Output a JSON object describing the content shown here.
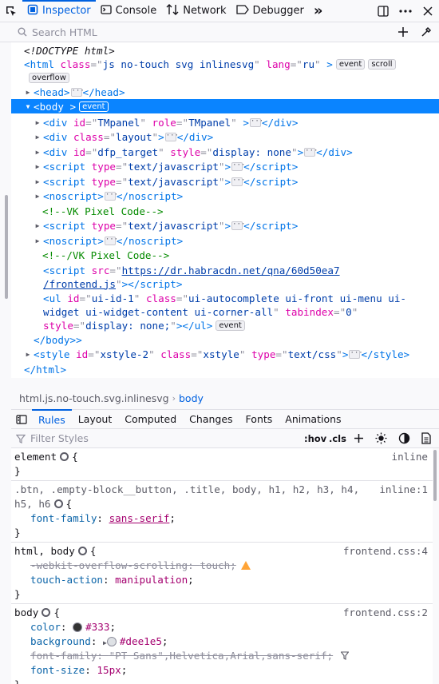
{
  "toolbar": {
    "tabs": [
      "Inspector",
      "Console",
      "Network",
      "Debugger"
    ],
    "overflow_label": "»"
  },
  "search": {
    "placeholder": "Search HTML"
  },
  "tree": {
    "doctype": "<!DOCTYPE html>",
    "html_open": {
      "tag": "<html",
      "attrs": [
        [
          "class",
          "js no-touch svg inlinesvg"
        ],
        [
          "lang",
          "ru"
        ]
      ],
      "badges": [
        "event",
        "scroll",
        "overflow"
      ]
    },
    "head": {
      "open": "<head",
      "close": "</head>"
    },
    "body": {
      "open": "<body",
      "badge": "event",
      "close": "</body>"
    },
    "children": [
      {
        "tag": "div",
        "attrs": [
          [
            "id",
            "TMpanel"
          ],
          [
            "role",
            "TMpanel"
          ]
        ]
      },
      {
        "tag": "div",
        "attrs": [
          [
            "class",
            "layout"
          ]
        ]
      },
      {
        "tag": "div",
        "attrs": [
          [
            "id",
            "dfp_target"
          ],
          [
            "style",
            "display: none"
          ]
        ]
      },
      {
        "tag": "script",
        "attrs": [
          [
            "type",
            "text/javascript"
          ]
        ]
      },
      {
        "tag": "script",
        "attrs": [
          [
            "type",
            "text/javascript"
          ]
        ]
      },
      {
        "tag": "noscript",
        "attrs": []
      },
      {
        "comment": "<!--VK Pixel Code-->"
      },
      {
        "tag": "script",
        "attrs": [
          [
            "type",
            "text/javascript"
          ]
        ]
      },
      {
        "tag": "noscript",
        "attrs": []
      },
      {
        "comment": "<!--/VK Pixel Code-->"
      }
    ],
    "script_src": {
      "attr": "src",
      "line1": "https://dr.habracdn.net/qna/60d50ea7",
      "line2": "/frontend.js"
    },
    "ul": {
      "line1_id": "ui-id-1",
      "line1_class": "ui-autocomplete ui-front ui-menu ui-",
      "line2_class": "widget ui-widget-content ui-corner-all",
      "tabindex": "0",
      "style": "display: none;",
      "badge": "event"
    },
    "style": {
      "attrs": [
        [
          "id",
          "xstyle-2"
        ],
        [
          "class",
          "xstyle"
        ],
        [
          "type",
          "text/css"
        ]
      ]
    },
    "html_close": "</html>"
  },
  "breadcrumb": {
    "item1": "html.js.no-touch.svg.inlinesvg",
    "item2": "body"
  },
  "panel_tabs": [
    "Rules",
    "Layout",
    "Computed",
    "Changes",
    "Fonts",
    "Animations"
  ],
  "filter": {
    "placeholder": "Filter Styles",
    "hov": ":hov",
    "cls": ".cls"
  },
  "rules": {
    "r1": {
      "selector": "element",
      "source": "inline"
    },
    "r2": {
      "selector_line1": ".btn, .empty-block__button, .title, body, h1, h2, h3, h4,",
      "source": "inline:1",
      "selector_line2": "h5, h6",
      "prop": "font-family",
      "val": "sans-serif"
    },
    "r3": {
      "selector": "html, body",
      "source": "frontend.css:4",
      "p1": "-webkit-overflow-scrolling",
      "v1": "touch",
      "p2": "touch-action",
      "v2": "manipulation"
    },
    "r4": {
      "selector": "body",
      "source": "frontend.css:2",
      "p1": "color",
      "v1": "#333",
      "p2": "background",
      "v2": "#dee1e5",
      "p3": "font-family",
      "v3": "\"PT Sans\",Helvetica,Arial,sans-serif",
      "p4": "font-size",
      "v4": "15px"
    }
  }
}
